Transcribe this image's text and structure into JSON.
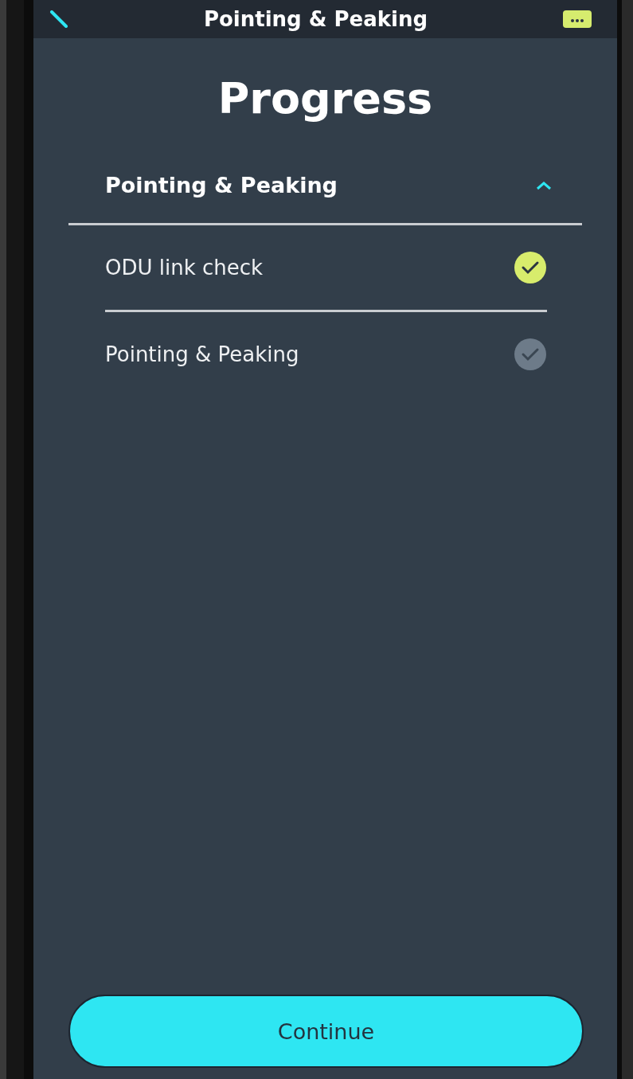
{
  "header": {
    "title": "Pointing & Peaking"
  },
  "heading": "Progress",
  "section": {
    "title": "Pointing & Peaking",
    "expanded": true,
    "steps": [
      {
        "label": "ODU link check",
        "completed": true
      },
      {
        "label": "Pointing & Peaking",
        "completed": false
      }
    ]
  },
  "button": "Continue"
}
